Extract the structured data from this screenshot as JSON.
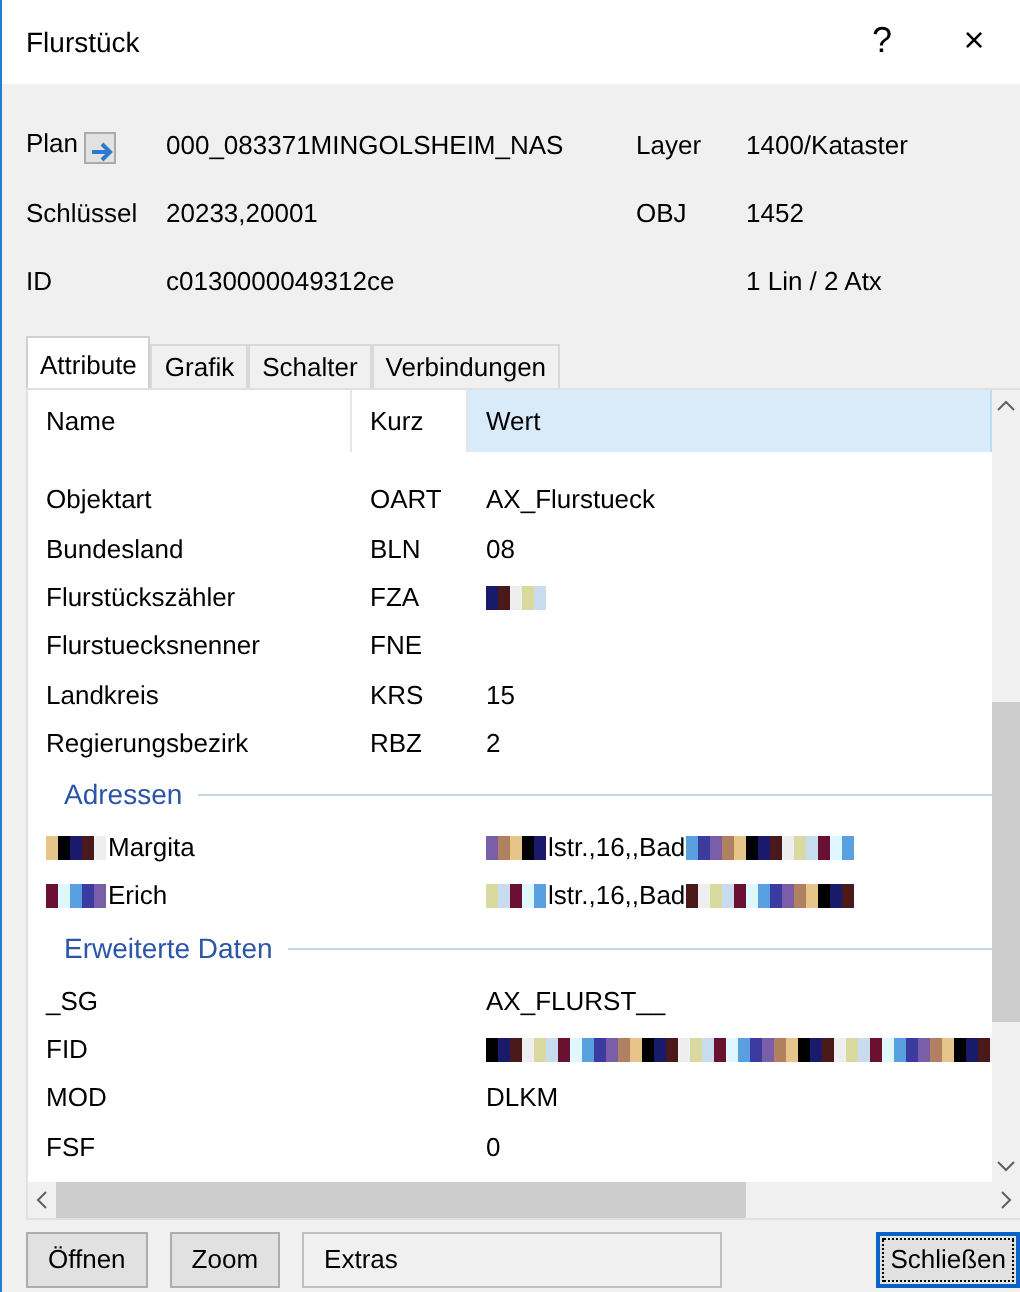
{
  "window": {
    "title": "Flurstück",
    "help": "?",
    "close": "×"
  },
  "info": [
    {
      "label": "Plan",
      "link_icon": true,
      "value": "000_083371MINGOLSHEIM_NAS",
      "label2": "Layer",
      "value2": "1400/Kataster"
    },
    {
      "label": "Schlüssel",
      "value": "20233,20001",
      "label2": "OBJ",
      "value2": "1452"
    },
    {
      "label": "ID",
      "value": "c0130000049312ce",
      "value2": "1 Lin / 2 Atx"
    }
  ],
  "tabs": [
    {
      "label": "Attribute",
      "selected": true
    },
    {
      "label": "Grafik",
      "selected": false
    },
    {
      "label": "Schalter",
      "selected": false
    },
    {
      "label": "Verbindungen",
      "selected": false
    }
  ],
  "table": {
    "columns": [
      {
        "label": "Name",
        "selected": false
      },
      {
        "label": "Kurz",
        "selected": false
      },
      {
        "label": "Wert",
        "selected": true
      }
    ],
    "rows": [
      {
        "kind": "row",
        "name": [
          {
            "kind": "text",
            "text": "Objektart"
          }
        ],
        "short": "OART",
        "value": [
          {
            "kind": "text",
            "text": "AX_Flurstueck"
          }
        ]
      },
      {
        "kind": "row",
        "name": [
          {
            "kind": "text",
            "text": "Bundesland"
          }
        ],
        "short": "BLN",
        "value": [
          {
            "kind": "text",
            "text": "08"
          }
        ]
      },
      {
        "kind": "row",
        "name": [
          {
            "kind": "text",
            "text": "Flurstückszähler"
          }
        ],
        "short": "FZA",
        "value": [
          {
            "kind": "mosaic_short"
          }
        ]
      },
      {
        "kind": "row",
        "name": [
          {
            "kind": "text",
            "text": "Flurstuecksnenner"
          }
        ],
        "short": "FNE"
      },
      {
        "kind": "row",
        "name": [
          {
            "kind": "text",
            "text": "Landkreis"
          }
        ],
        "short": "KRS",
        "value": [
          {
            "kind": "text",
            "text": "15"
          }
        ]
      },
      {
        "kind": "row",
        "name": [
          {
            "kind": "text",
            "text": "Regierungsbezirk"
          }
        ],
        "short": "RBZ",
        "value": [
          {
            "kind": "text",
            "text": "2"
          }
        ]
      },
      {
        "kind": "section",
        "title": "Adressen"
      },
      {
        "kind": "row",
        "name": [
          {
            "kind": "mosaic_short"
          },
          {
            "kind": "text",
            "text": "Margita"
          }
        ],
        "value": [
          {
            "kind": "mosaic_short"
          },
          {
            "kind": "text",
            "text": "lstr.,16,,Bad"
          },
          {
            "kind": "mosaic_medium"
          }
        ]
      },
      {
        "kind": "row",
        "name": [
          {
            "kind": "mosaic_short"
          },
          {
            "kind": "text",
            "text": "Erich"
          }
        ],
        "value": [
          {
            "kind": "mosaic_short"
          },
          {
            "kind": "text",
            "text": "lstr.,16,,Bad"
          },
          {
            "kind": "mosaic_medium"
          }
        ]
      },
      {
        "kind": "section",
        "title": "Erweiterte Daten"
      },
      {
        "kind": "row",
        "name": [
          {
            "kind": "text",
            "text": "_SG"
          }
        ],
        "value": [
          {
            "kind": "text",
            "text": "AX_FLURST__"
          }
        ]
      },
      {
        "kind": "row",
        "name": [
          {
            "kind": "text",
            "text": "FID"
          }
        ],
        "value": [
          {
            "kind": "mosaic_long"
          }
        ]
      },
      {
        "kind": "row",
        "name": [
          {
            "kind": "text",
            "text": "MOD"
          }
        ],
        "value": [
          {
            "kind": "text",
            "text": "DLKM"
          }
        ]
      },
      {
        "kind": "row",
        "name": [
          {
            "kind": "text",
            "text": "FSF"
          }
        ],
        "value": [
          {
            "kind": "text",
            "text": "0"
          }
        ]
      }
    ]
  },
  "buttons": [
    {
      "label": "Öffnen",
      "kind": "button",
      "focused": false
    },
    {
      "label": "Zoom",
      "kind": "button",
      "focused": false
    },
    {
      "label": "Extras",
      "kind": "wide",
      "focused": false
    },
    {
      "label": "Schließen",
      "kind": "button",
      "focused": true
    }
  ]
}
